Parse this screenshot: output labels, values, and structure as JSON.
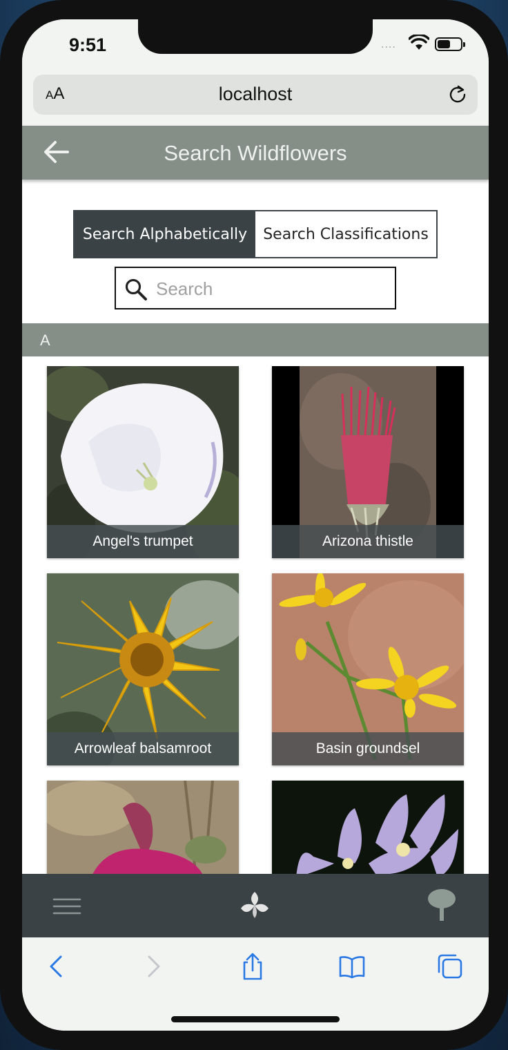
{
  "status_bar": {
    "time": "9:51",
    "signal": "....",
    "wifi": "wifi-icon",
    "battery": "battery-icon"
  },
  "browser": {
    "text_size_label_small": "A",
    "text_size_label_large": "A",
    "url": "localhost",
    "reload": "reload-icon"
  },
  "header": {
    "title": "Search Wildflowers",
    "back": "back-arrow-icon"
  },
  "search_mode": {
    "options": [
      {
        "label": "Search Alphabetically",
        "selected": true
      },
      {
        "label": "Search Classifications",
        "selected": false
      }
    ]
  },
  "search": {
    "placeholder": "Search",
    "value": "",
    "icon": "search-icon"
  },
  "section": {
    "letter": "A"
  },
  "flowers": [
    {
      "name": "Angel's trumpet"
    },
    {
      "name": "Arizona thistle"
    },
    {
      "name": "Arrowleaf balsamroot"
    },
    {
      "name": "Basin groundsel"
    },
    {
      "name": ""
    },
    {
      "name": ""
    }
  ],
  "tab_bar": {
    "items": [
      "menu-icon",
      "flower-icon",
      "tree-icon"
    ]
  },
  "safari_toolbar": {
    "items": [
      "back-icon",
      "forward-icon",
      "share-icon",
      "bookmarks-icon",
      "tabs-icon"
    ]
  },
  "colors": {
    "header": "#858f88",
    "dark": "#3b4246",
    "caption": "#464e52"
  }
}
